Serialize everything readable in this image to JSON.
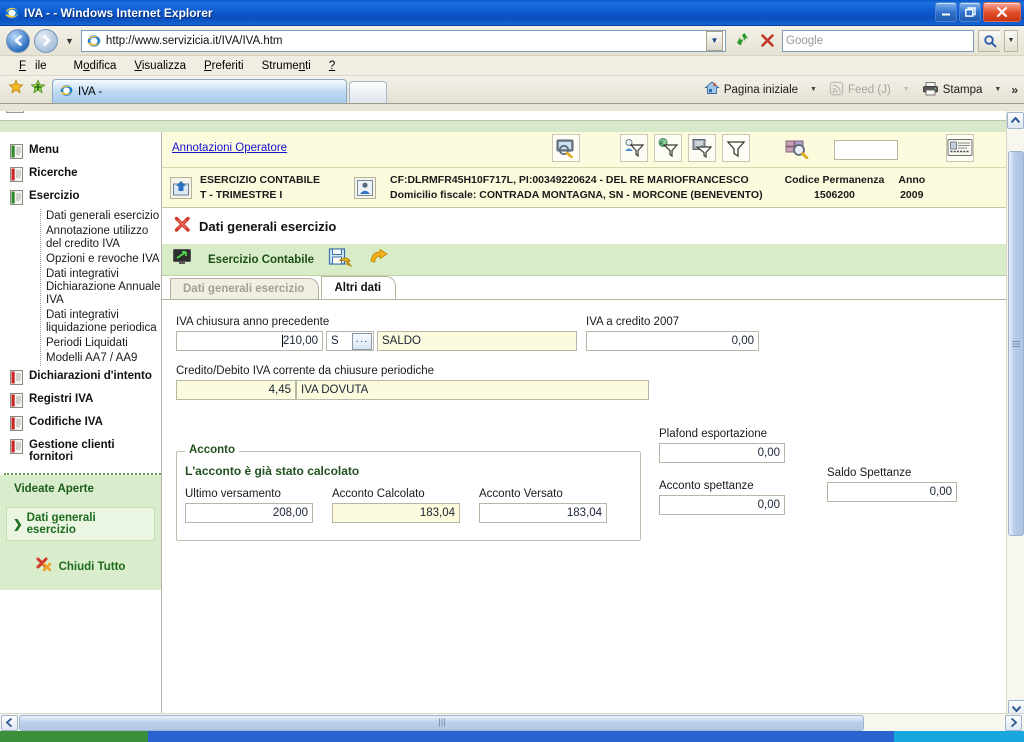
{
  "window": {
    "title": "IVA - - Windows Internet Explorer",
    "minimize_label": "_",
    "restore_label": "❐",
    "close_label": "✕"
  },
  "address_bar": {
    "url": "http://www.servizicia.it/IVA/IVA.htm",
    "dropdown_icon": "chevron-down-icon",
    "refresh_icon": "refresh-icon",
    "stop_icon": "stop-icon",
    "search_placeholder": "Google",
    "search_icon": "magnifier-icon",
    "search_dropdown_icon": "chevron-down-icon",
    "back_icon": "back-arrow-icon",
    "forward_icon": "forward-arrow-icon"
  },
  "menu": {
    "items": [
      "File",
      "Modifica",
      "Visualizza",
      "Preferiti",
      "Strumenti",
      "?"
    ]
  },
  "tabs_row": {
    "favorites_icon": "star-icon",
    "add_favorite_icon": "add-star-icon",
    "tab_label": "IVA -",
    "new_tab_label": "",
    "commands": [
      {
        "label": "Pagina iniziale",
        "icon": "home-icon",
        "disabled": false,
        "has_arrow": true
      },
      {
        "label": "Feed (J)",
        "icon": "feed-icon",
        "disabled": true,
        "has_arrow": true
      },
      {
        "label": "Stampa",
        "icon": "printer-icon",
        "disabled": false,
        "has_arrow": true
      }
    ],
    "overflow_label": "»"
  },
  "sidebar": {
    "roots": [
      {
        "label": "Menu",
        "color": "#2e8b2e"
      },
      {
        "label": "Ricerche",
        "color": "#c62828"
      },
      {
        "label": "Esercizio",
        "color": "#2e8b2e"
      }
    ],
    "esercizio_children": [
      "Dati generali esercizio",
      "Annotazione utilizzo del credito IVA",
      "Opzioni e revoche IVA",
      "Dati integrativi Dichiarazione Annuale IVA",
      "Dati integrativi liquidazione periodica",
      "Periodi Liquidati",
      "Modelli AA7 / AA9"
    ],
    "roots_after": [
      {
        "label": "Dichiarazioni d'intento",
        "color": "#c62828"
      },
      {
        "label": "Registri IVA",
        "color": "#c62828"
      },
      {
        "label": "Codifiche IVA",
        "color": "#c62828"
      },
      {
        "label": "Gestione clienti fornitori",
        "color": "#c62828"
      }
    ],
    "open_views_title": "Videate Aperte",
    "open_views": [
      {
        "label": "Dati generali esercizio",
        "marker": "❯"
      }
    ],
    "close_all_label": "Chiudi Tutto",
    "close_all_icon": "close-all-icon"
  },
  "header": {
    "annotations_link": "Annotazioni Operatore",
    "toolbar_icons": [
      "search-screen-icon",
      "person-filter-icon",
      "money-filter-icon",
      "document-filter-icon",
      "filter-icon",
      "archive-search-icon",
      "id-card-icon"
    ],
    "blank_field_value": "",
    "company": {
      "icon": "building-icon",
      "line1": "ESERCIZIO CONTABILE",
      "line2": "T  - TRIMESTRE I"
    },
    "subject": {
      "icon": "person-icon",
      "line1": "CF:DLRMFR45H10F717L, PI:00349220624 - DEL RE MARIOFRANCESCO",
      "line2": "Domicilio fiscale: CONTRADA MONTAGNA, SN - MORCONE (BENEVENTO)"
    },
    "codice_permanenza_label": "Codice Permanenza",
    "codice_permanenza_value": "1506200",
    "anno_label": "Anno",
    "anno_value": "2009"
  },
  "page_title": {
    "icon": "red-x-icon",
    "text": "Dati generali esercizio"
  },
  "green_toolbar": {
    "screen_icon": "monitor-icon",
    "label": "Esercizio Contabile",
    "save_icon": "save-icon",
    "undo_icon": "undo-arrow-icon"
  },
  "form_tabs": [
    {
      "label": "Dati generali esercizio",
      "active": false
    },
    {
      "label": "Altri dati",
      "active": true
    }
  ],
  "form": {
    "iva_chiusura_label": "IVA chiusura anno precedente",
    "iva_chiusura_value": "210,00",
    "iva_chiusura_code": "S",
    "iva_chiusura_code_btn": "···",
    "iva_chiusura_desc": "SALDO",
    "iva_credito_label": "IVA a credito 2007",
    "iva_credito_value": "0,00",
    "credito_debito_label": "Credito/Debito IVA corrente da chiusure periodiche",
    "credito_debito_value": "4,45",
    "credito_debito_desc": "IVA DOVUTA",
    "acconto": {
      "legend": "Acconto",
      "subtitle": "L'acconto è già stato calcolato",
      "ultimo_versamento_label": "Ultimo versamento",
      "ultimo_versamento_value": "208,00",
      "acconto_calcolato_label": "Acconto Calcolato",
      "acconto_calcolato_value": "183,04",
      "acconto_versato_label": "Acconto Versato",
      "acconto_versato_value": "183,04"
    },
    "plafond_label": "Plafond esportazione",
    "plafond_value": "0,00",
    "acconto_spettanze_label": "Acconto spettanze",
    "acconto_spettanze_value": "0,00",
    "saldo_spettanze_label": "Saldo Spettanze",
    "saldo_spettanze_value": "0,00"
  },
  "scrollbars": {
    "up_icon": "▲",
    "down_icon": "▼",
    "left_icon": "❮",
    "right_icon": "❯",
    "grip": "‖"
  },
  "colors": {
    "accent_blue": "#0d5ad0",
    "panel_yellow": "#fcfbdd",
    "panel_green": "#d7ecc7",
    "link_blue": "#1414cf",
    "green_text": "#1d6b1d",
    "red": "#c62828"
  }
}
